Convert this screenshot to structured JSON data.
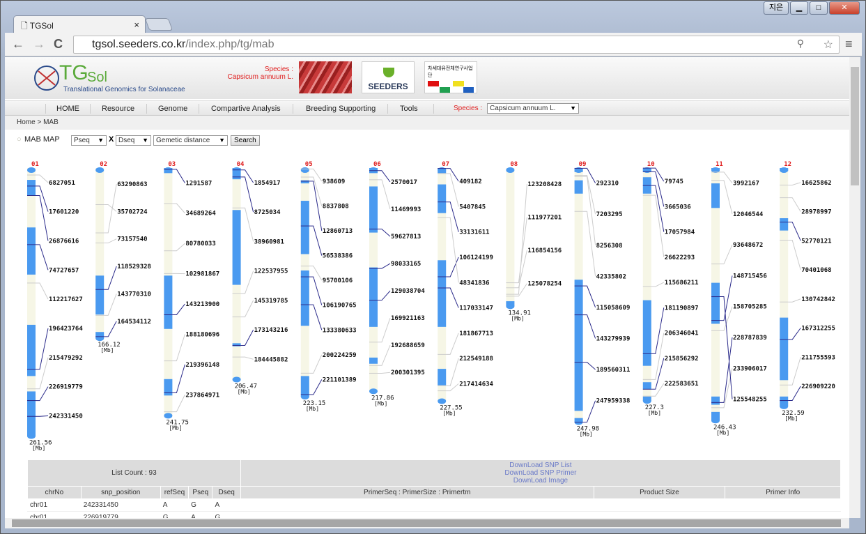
{
  "browser": {
    "tab_title": "TGSol",
    "tab_close": "×",
    "url_host": "tgsol.seeders.co.kr",
    "url_path": "/index.php/tg/mab",
    "user_button": "지은",
    "min": "▁",
    "max": "□",
    "close": "✕",
    "back": "←",
    "forward": "→",
    "reload": "C"
  },
  "header": {
    "logo_tg": "TG",
    "logo_sol": "Sol",
    "logo_sub": "Translational Genomics for Solanaceae",
    "species_label": "Species :",
    "species_value": "Capsicum annuum L.",
    "partner1": "SEEDERS",
    "partner2": "차세대유전체연구사업단"
  },
  "menu": {
    "items": [
      "HOME",
      "Resource",
      "Genome",
      "Compartive Analysis",
      "Breeding Supporting",
      "Tools"
    ],
    "species_label": "Species :",
    "species_select": "Capsicum annuum L."
  },
  "breadcrumb": "Home > MAB",
  "controls": {
    "title": "MAB MAP",
    "select1": "Pseq",
    "x": "X",
    "select2": "Dseq",
    "select3": "Gemetic distance",
    "search": "Search"
  },
  "colors": {
    "band": "#4a9af0",
    "chrom": "#f6f6e6",
    "leader": "#2a2a8a",
    "chr_label": "#e02020"
  },
  "chromosomes": [
    {
      "id": "01",
      "length": "261.56",
      "unit": "[Mb]",
      "bands": [
        [
          11.6,
          27
        ],
        [
          58,
          104
        ],
        [
          153,
          203
        ],
        [
          218,
          261.56
        ]
      ],
      "markers": [
        "6827051",
        "17601220",
        "26876616",
        "74727657",
        "112217627",
        "196423764",
        "215479292",
        "226919779",
        "242331450"
      ]
    },
    {
      "id": "02",
      "length": "166.12",
      "unit": "[Mb]",
      "bands": [
        [
          105,
          143
        ],
        [
          160,
          166.12
        ]
      ],
      "markers": [
        "63290863",
        "35702724",
        "73157540",
        "118529328",
        "143770310",
        "164534112"
      ]
    },
    {
      "id": "03",
      "length": "241.75",
      "unit": "[Mb]",
      "bands": [
        [
          0,
          5
        ],
        [
          105,
          157
        ],
        [
          206,
          222
        ]
      ],
      "markers": [
        "1291587",
        "34689264",
        "80780033",
        "102981867",
        "143213900",
        "188180696",
        "219396148",
        "237864971"
      ]
    },
    {
      "id": "04",
      "length": "206.47",
      "unit": "[Mb]",
      "bands": [
        [
          0,
          11
        ],
        [
          41,
          114
        ],
        [
          171,
          174
        ]
      ],
      "markers": [
        "1854917",
        "8725034",
        "38960981",
        "122537955",
        "145319785",
        "173143216",
        "184445882"
      ]
    },
    {
      "id": "05",
      "length": "223.15",
      "unit": "[Mb]",
      "bands": [
        [
          12,
          15
        ],
        [
          32,
          84
        ],
        [
          100,
          154
        ],
        [
          203,
          223.15
        ]
      ],
      "markers": [
        "938609",
        "8837808",
        "12860713",
        "56538386",
        "95700106",
        "106190765",
        "133380633",
        "200224259",
        "221101389"
      ]
    },
    {
      "id": "06",
      "length": "217.86",
      "unit": "[Mb]",
      "bands": [
        [
          0,
          5
        ],
        [
          18,
          63
        ],
        [
          97,
          155
        ],
        [
          185,
          191
        ]
      ],
      "markers": [
        "2570017",
        "11469993",
        "59627813",
        "98033165",
        "129038704",
        "169921163",
        "192688659",
        "200301395"
      ]
    },
    {
      "id": "07",
      "length": "227.55",
      "unit": "[Mb]",
      "bands": [
        [
          0,
          5
        ],
        [
          16,
          44
        ],
        [
          90,
          155
        ],
        [
          196,
          212
        ]
      ],
      "markers": [
        "409182",
        "5407845",
        "33131611",
        "106124199",
        "48341836",
        "117033147",
        "181867713",
        "212549188",
        "217414634"
      ]
    },
    {
      "id": "08",
      "length": "134.91",
      "unit": "[Mb]",
      "bands": [
        [
          130,
          134.91
        ]
      ],
      "markers": [
        "123208428",
        "111977201",
        "116854156",
        "125078254"
      ]
    },
    {
      "id": "09",
      "length": "247.98",
      "unit": "[Mb]",
      "bands": [
        [
          0,
          4
        ],
        [
          12,
          25
        ],
        [
          109,
          237
        ],
        [
          244,
          247.98
        ]
      ],
      "markers": [
        "292310",
        "7203295",
        "8256308",
        "42335802",
        "115058609",
        "143279939",
        "189560311",
        "247959338"
      ]
    },
    {
      "id": "10",
      "length": "227.3",
      "unit": "[Mb]",
      "bands": [
        [
          0,
          4
        ],
        [
          9,
          25
        ],
        [
          129,
          193
        ],
        [
          209,
          216
        ],
        [
          223,
          227.3
        ]
      ],
      "markers": [
        "79745",
        "3665036",
        "17057984",
        "26622293",
        "115686211",
        "181190897",
        "206346041",
        "215856292",
        "222583651"
      ]
    },
    {
      "id": "11",
      "length": "246.43",
      "unit": "[Mb]",
      "bands": [
        [
          0,
          3
        ],
        [
          15,
          39
        ],
        [
          112,
          152
        ],
        [
          223,
          231
        ],
        [
          238,
          246.43
        ]
      ],
      "markers": [
        "3992167",
        "12046544",
        "93648672",
        "148715456",
        "158705285",
        "228787839",
        "233906017",
        "125548255"
      ]
    },
    {
      "id": "12",
      "length": "232.59",
      "unit": "[Mb]",
      "bands": [
        [
          0,
          3
        ],
        [
          49,
          61
        ],
        [
          146,
          207
        ],
        [
          223,
          232.59
        ]
      ],
      "markers": [
        "16625862",
        "28978997",
        "52770121",
        "70401068",
        "130742842",
        "167312255",
        "211755593",
        "226909220"
      ]
    }
  ],
  "table": {
    "list_count": "List Count : 93",
    "downloads": [
      "DownLoad SNP List",
      "DownLoad SNP Primer",
      "DownLoad Image"
    ],
    "columns": [
      "chrNo",
      "snp_position",
      "refSeq",
      "Pseq",
      "Dseq",
      "PrimerSeq : PrimerSize : Primertm",
      "Product Size",
      "Primer Info"
    ],
    "rows": [
      [
        "chr01",
        "242331450",
        "A",
        "G",
        "A",
        "",
        "",
        ""
      ],
      [
        "chr01",
        "226919779",
        "G",
        "A",
        "G",
        "",
        "",
        ""
      ]
    ]
  }
}
